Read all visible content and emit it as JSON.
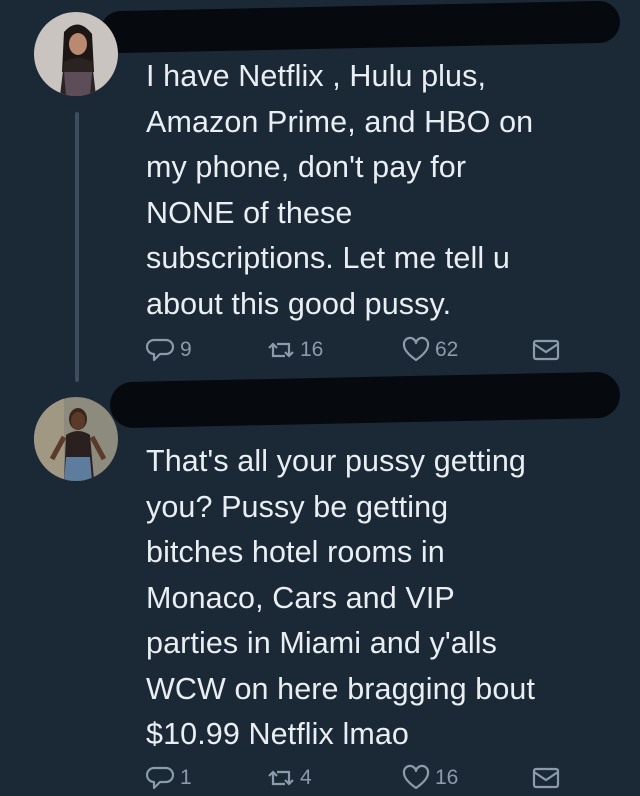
{
  "tweets": [
    {
      "text": "I have Netflix , Hulu plus,\nAmazon Prime, and HBO on\nmy phone, don't pay for\nNONE of these\nsubscriptions. Let me tell u\nabout this good pussy.",
      "replies": "9",
      "retweets": "16",
      "likes": "62",
      "icons": [
        "reply-icon",
        "retweet-icon",
        "heart-icon",
        "mail-icon"
      ]
    },
    {
      "text": "That's all your pussy getting\nyou? Pussy be getting\nbitches hotel rooms in\nMonaco, Cars and VIP\nparties in Miami and y'alls\nWCW on here bragging bout\n$10.99 Netflix lmao",
      "replies": "1",
      "retweets": "4",
      "likes": "16",
      "icons": [
        "reply-icon",
        "retweet-icon",
        "heart-icon",
        "mail-icon"
      ]
    }
  ],
  "colors": {
    "background": "#1b2836",
    "text": "#e9eef2",
    "muted": "#8a9bab",
    "thread_line": "#3c4d5e"
  }
}
